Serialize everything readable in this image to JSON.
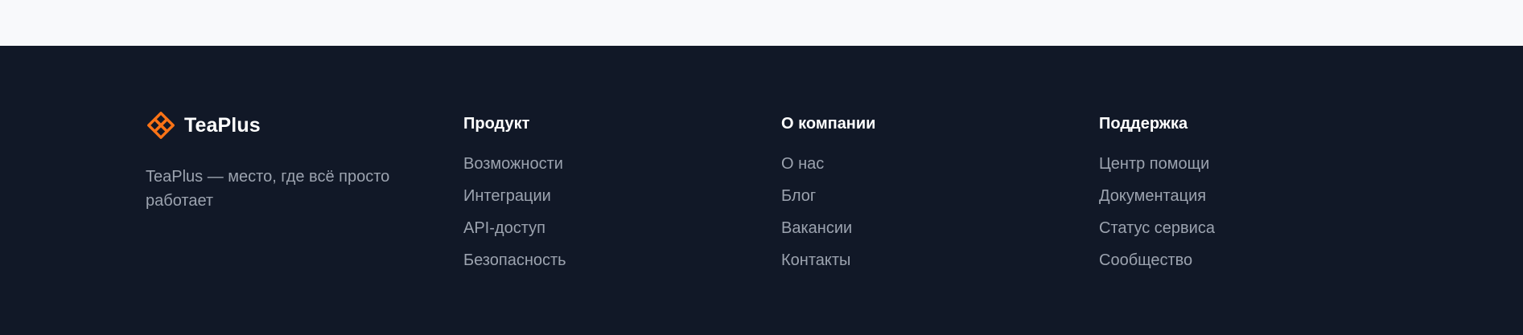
{
  "colors": {
    "page_background": "#f8f9fb",
    "footer_background": "#111827",
    "brand_accent": "#f97316",
    "heading_text": "#ffffff",
    "link_text": "#9ca3af"
  },
  "brand": {
    "icon": "orange-knot-logo-icon",
    "name": "TeaPlus",
    "tagline": "TeaPlus — место, где всё просто работает"
  },
  "columns": [
    {
      "title": "Продукт",
      "links": [
        "Возможности",
        "Интеграции",
        "API-доступ",
        "Безопасность"
      ]
    },
    {
      "title": "О компании",
      "links": [
        "О нас",
        "Блог",
        "Вакансии",
        "Контакты"
      ]
    },
    {
      "title": "Поддержка",
      "links": [
        "Центр помощи",
        "Документация",
        "Статус сервиса",
        "Сообщество"
      ]
    }
  ]
}
